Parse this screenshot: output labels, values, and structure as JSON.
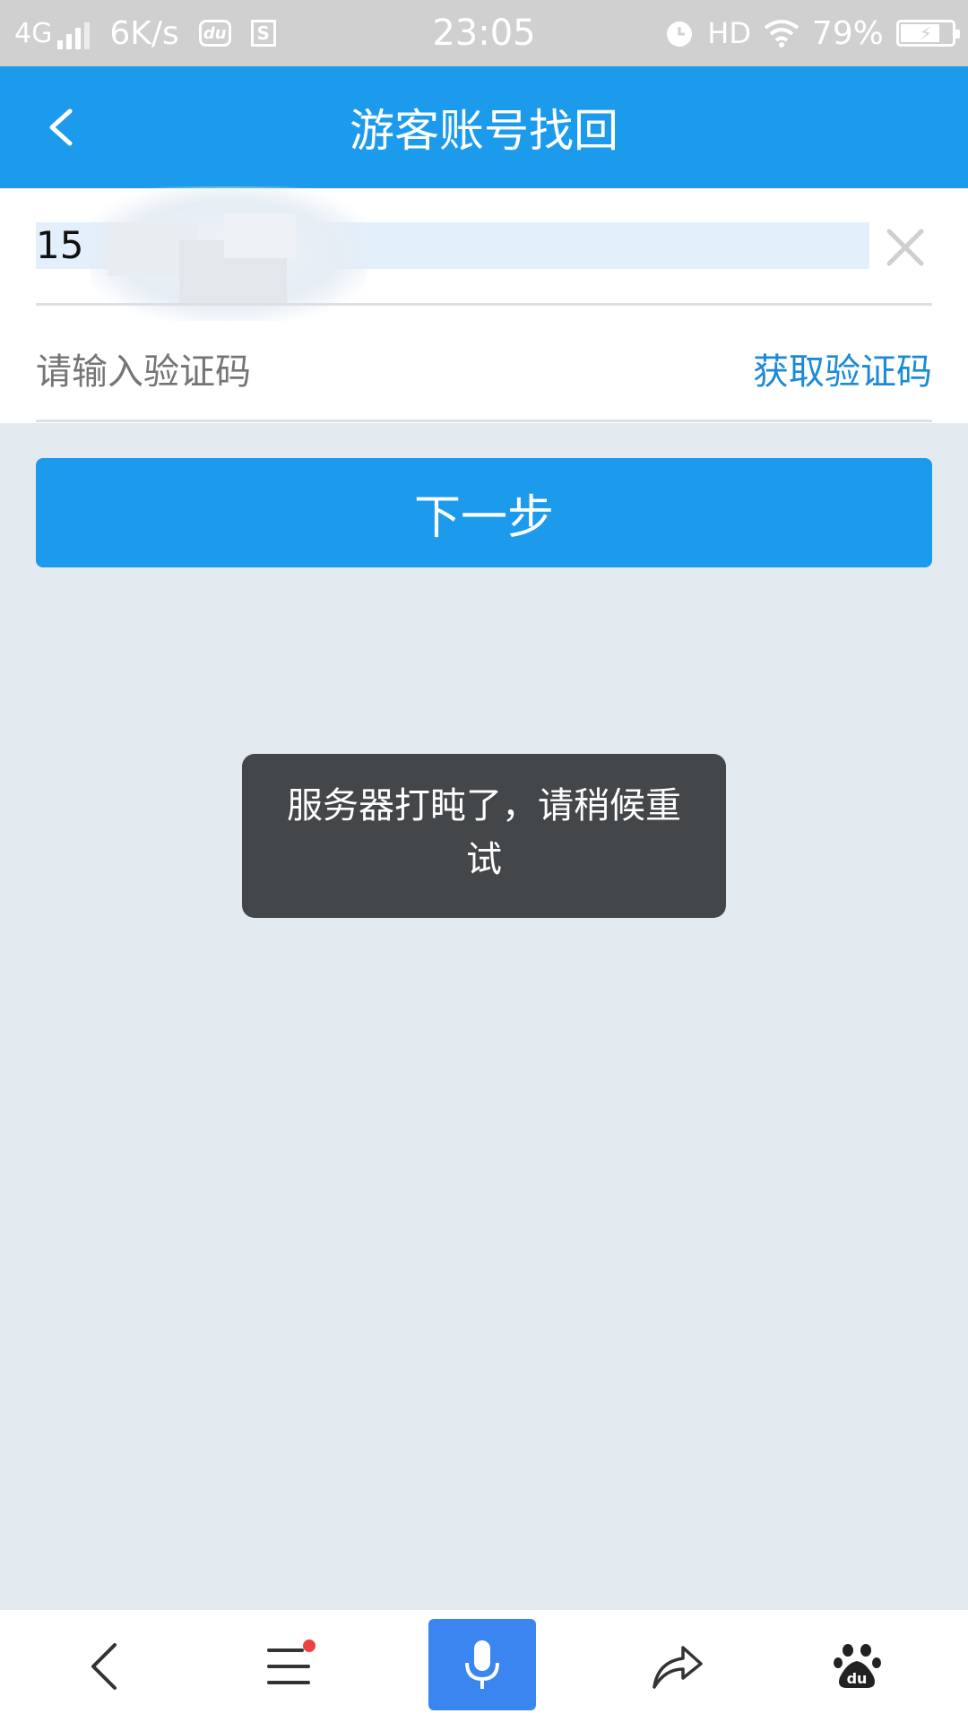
{
  "status_bar": {
    "network": "4G",
    "speed": "6K/s",
    "app_icon_text": "du",
    "s_icon_text": "S",
    "time": "23:05",
    "hd": "HD",
    "battery_percent": "79%",
    "battery_level": 0.79,
    "icons": [
      "signal-icon",
      "baidu-app-icon",
      "s-app-icon",
      "alarm-icon",
      "wifi-icon",
      "battery-icon"
    ]
  },
  "header": {
    "title": "游客账号找回",
    "back_icon": "chevron-left-icon"
  },
  "form": {
    "phone_value": "15",
    "clear_icon": "close-icon",
    "code_placeholder": "请输入验证码",
    "get_code_label": "获取验证码"
  },
  "next_button": {
    "label": "下一步"
  },
  "toast": {
    "message": "服务器打盹了，请稍候重试"
  },
  "bottom_nav": {
    "items": [
      {
        "icon": "back-icon"
      },
      {
        "icon": "menu-icon",
        "has_notification_dot": true
      },
      {
        "icon": "microphone-icon"
      },
      {
        "icon": "share-icon"
      },
      {
        "icon": "baidu-paw-icon",
        "text": "du"
      }
    ]
  },
  "colors": {
    "primary": "#1c9bec",
    "link": "#1c8ad6",
    "background": "#e3ebf0",
    "toast": "#444749",
    "mic": "#3a85f0",
    "notification": "#f04141"
  }
}
